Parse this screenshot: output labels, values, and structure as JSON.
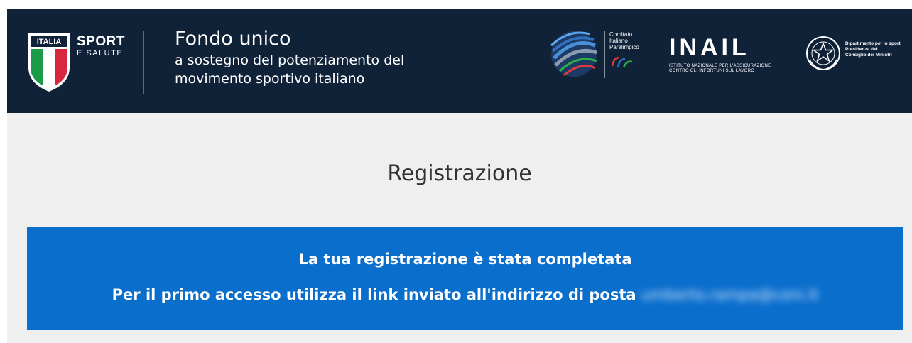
{
  "header": {
    "sport_logo": {
      "badge": "ITALIA",
      "line1": "SPORT",
      "line2": "E SALUTE"
    },
    "title": "Fondo unico",
    "subtitle_line1": "a sostegno del potenziamento del",
    "subtitle_line2": "movimento sportivo italiano",
    "cip_logo": {
      "line1": "Comitato",
      "line2": "Italiano",
      "line3": "Paralimpico"
    },
    "inail_logo": {
      "word": "INAIL",
      "sub1": "ISTITUTO NAZIONALE PER L'ASSICURAZIONE",
      "sub2": "CONTRO GLI INFORTUNI SUL LAVORO"
    },
    "dps_logo": {
      "line1": "Dipartimento per lo sport",
      "line2": "Presidenza del",
      "line3": "Consiglio dei Ministri"
    }
  },
  "main": {
    "title": "Registrazione",
    "alert": {
      "line1": "La tua registrazione è stata completata",
      "line2": "Per il primo accesso utilizza il link inviato all'indirizzo di posta",
      "email": "umberto.rampa@coni.it"
    }
  },
  "colors": {
    "header_bg": "#0f2238",
    "content_bg": "#efefef",
    "alert_bg": "#0a6ecc"
  }
}
